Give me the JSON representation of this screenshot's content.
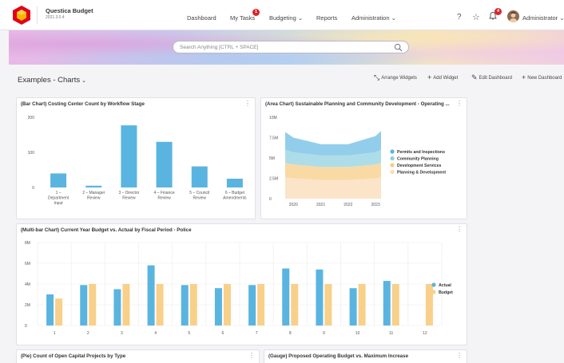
{
  "app": {
    "name": "Questica Budget",
    "version": "2021.3.0.4"
  },
  "nav": {
    "dashboard": "Dashboard",
    "my_tasks": "My Tasks",
    "my_tasks_badge": "1",
    "budgeting": "Budgeting",
    "reports": "Reports",
    "administration": "Administration"
  },
  "header_icons": {
    "help": "?",
    "favorites": "☆",
    "notifications_badge": "4"
  },
  "user": {
    "name": "Administrator"
  },
  "search": {
    "placeholder": "Search Anything [CTRL + SPACE]"
  },
  "page": {
    "title": "Examples - Charts"
  },
  "toolbar": {
    "arrange": "Arrange Widgets",
    "add": "Add Widget",
    "edit": "Edit Dashboard",
    "new": "New Dashboard"
  },
  "widgets": {
    "bar": {
      "title": "(Bar Chart) Costing Center Count by Workflow Stage"
    },
    "area": {
      "title": "(Area Chart) Sustainable Planning and Community Development - Operating ..."
    },
    "multibar": {
      "title": "(Multi-bar Chart) Current Year Budget vs. Actual by Fiscal Period - Police"
    },
    "pie": {
      "title": "(Pie) Count of Open Capital Projects by Type"
    },
    "gauge": {
      "title": "(Gauge) Proposed Operating Budget vs. Maximum Increase"
    }
  },
  "colors": {
    "accent": "#e2001a",
    "bar_blue": "#5ab4e0",
    "budget_orange": "#f8d08a",
    "area_blue": "#8ccbea",
    "area_teal": "#a9dbe7",
    "area_orange": "#f9d8a0",
    "area_peach": "#fbe3c4"
  },
  "chart_data": [
    {
      "type": "bar",
      "title": "(Bar Chart) Costing Center Count by Workflow Stage",
      "categories": [
        "1 – Department Input",
        "2 – Manager Review",
        "3 – Director Review",
        "4 – Finance Review",
        "5 – Council Review",
        "6 – Budget Amendments"
      ],
      "category_lines": [
        [
          "1 –",
          "Department",
          "Input"
        ],
        [
          "2 – Manager",
          "Review"
        ],
        [
          "3 – Director",
          "Review"
        ],
        [
          "4 – Finance",
          "Review"
        ],
        [
          "5 – Council",
          "Review"
        ],
        [
          "6 – Budget",
          "Amendments"
        ]
      ],
      "values": [
        40,
        5,
        177,
        130,
        60,
        25
      ],
      "ylim": [
        0,
        200
      ],
      "yticks": [
        0,
        100,
        200
      ],
      "grid": false
    },
    {
      "type": "area",
      "title": "(Area Chart) Sustainable Planning and Community Development - Operating ...",
      "x": [
        2019.7,
        2020,
        2021,
        2022,
        2023,
        2023.2
      ],
      "xticks": [
        "2020",
        "2021",
        "2022",
        "2023"
      ],
      "ylim": [
        0,
        10
      ],
      "yticks": [
        "0",
        "2.5M",
        "5M",
        "7.5M",
        "10M"
      ],
      "stacked": true,
      "legend": "right",
      "series": [
        {
          "name": "Planning & Development",
          "values": [
            2.6,
            2.5,
            2.3,
            2.3,
            2.5,
            2.6
          ]
        },
        {
          "name": "Development Services",
          "values": [
            1.8,
            1.7,
            1.6,
            1.6,
            1.7,
            1.8
          ]
        },
        {
          "name": "Community Planning",
          "values": [
            1.6,
            1.5,
            1.4,
            1.4,
            1.5,
            1.6
          ]
        },
        {
          "name": "Permits and Inspections",
          "values": [
            2.2,
            1.8,
            1.4,
            1.4,
            2.0,
            2.3
          ]
        }
      ],
      "legend_order": [
        "Permits and Inspections",
        "Community Planning",
        "Development Services",
        "Planning & Development"
      ]
    },
    {
      "type": "bar",
      "title": "(Multi-bar Chart) Current Year Budget vs. Actual by Fiscal Period - Police",
      "categories": [
        "1",
        "2",
        "3",
        "4",
        "5",
        "6",
        "7",
        "8",
        "9",
        "10",
        "11",
        "12"
      ],
      "ylim": [
        0,
        8
      ],
      "yticks": [
        "0",
        "2M",
        "4M",
        "6M",
        "8M"
      ],
      "legend": "right",
      "series": [
        {
          "name": "Actual",
          "values": [
            3.0,
            3.9,
            3.5,
            5.8,
            3.9,
            3.6,
            3.9,
            5.5,
            5.4,
            3.6,
            4.3,
            null
          ]
        },
        {
          "name": "Budget",
          "values": [
            2.6,
            4.0,
            4.0,
            4.0,
            4.0,
            4.0,
            4.0,
            4.0,
            4.0,
            4.0,
            4.0,
            4.0
          ]
        }
      ]
    }
  ]
}
